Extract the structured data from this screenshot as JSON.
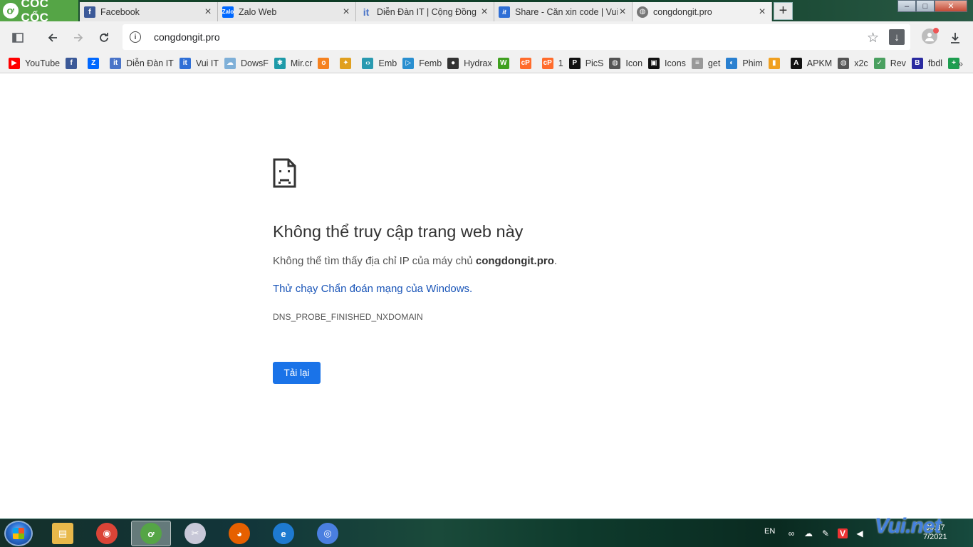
{
  "browser": {
    "brand_name": "CỐC CỐC",
    "tabs": [
      {
        "title": "Facebook",
        "icon": "facebook-icon",
        "color": "#3b5998",
        "glyph": "f"
      },
      {
        "title": "Zalo Web",
        "icon": "zalo-icon",
        "color": "#0068ff",
        "glyph": "Z"
      },
      {
        "title": "Diễn Đàn IT | Cộng Đồng IT",
        "icon": "it-icon",
        "color": "#4a74c8",
        "glyph": "it"
      },
      {
        "title": "Share - Căn xin code | Vui IT",
        "icon": "vuiit-icon",
        "color": "#2f6fd6",
        "glyph": "it"
      },
      {
        "title": "congdongit.pro",
        "icon": "globe-icon",
        "color": "#777777",
        "glyph": "◍"
      }
    ],
    "new_tab_label": "+",
    "window_buttons": {
      "minimize": "–",
      "maximize": "□",
      "close": "✕"
    }
  },
  "toolbar": {
    "url": "congdongit.pro",
    "info_glyph": "i"
  },
  "bookmarks": [
    {
      "label": "YouTube",
      "icon": "youtube-icon",
      "color": "#ff0000",
      "glyph": "▶"
    },
    {
      "label": "",
      "icon": "facebook-icon",
      "color": "#3b5998",
      "glyph": "f"
    },
    {
      "label": "",
      "icon": "zalo-icon",
      "color": "#0068ff",
      "glyph": "Z"
    },
    {
      "label": "Diễn Đàn IT",
      "icon": "it-icon",
      "color": "#4a74c8",
      "glyph": "it"
    },
    {
      "label": "Vui IT",
      "icon": "vuiit-icon",
      "color": "#2f6fd6",
      "glyph": "it"
    },
    {
      "label": "DowsF",
      "icon": "cloud-icon",
      "color": "#7fb0d8",
      "glyph": "☁"
    },
    {
      "label": "Mir.cr",
      "icon": "mirror-icon",
      "color": "#1e9aa8",
      "glyph": "✱"
    },
    {
      "label": "",
      "icon": "odnoklassniki-icon",
      "color": "#f58220",
      "glyph": "o"
    },
    {
      "label": "",
      "icon": "pinwheel-icon",
      "color": "#e0a020",
      "glyph": "✦"
    },
    {
      "label": "Emb",
      "icon": "code-icon",
      "color": "#2a9ab0",
      "glyph": "‹›"
    },
    {
      "label": "Femb",
      "icon": "play-icon",
      "color": "#2a8fd0",
      "glyph": "▷"
    },
    {
      "label": "Hydrax",
      "icon": "hydrax-icon",
      "color": "#333333",
      "glyph": "●"
    },
    {
      "label": "",
      "icon": "whatsapp-icon",
      "color": "#40a020",
      "glyph": "W"
    },
    {
      "label": "",
      "icon": "cpanel-icon",
      "color": "#ff6c2c",
      "glyph": "cP"
    },
    {
      "label": "1",
      "icon": "cpanel-icon",
      "color": "#ff6c2c",
      "glyph": "cP"
    },
    {
      "label": "PicS",
      "icon": "pics-icon",
      "color": "#111111",
      "glyph": "P"
    },
    {
      "label": "Icon",
      "icon": "globe-icon",
      "color": "#555555",
      "glyph": "◍"
    },
    {
      "label": "Icons",
      "icon": "icons-icon",
      "color": "#111111",
      "glyph": "▣"
    },
    {
      "label": "get",
      "icon": "document-icon",
      "color": "#999999",
      "glyph": "≡"
    },
    {
      "label": "Phim",
      "icon": "phim-icon",
      "color": "#2a80d0",
      "glyph": "◐"
    },
    {
      "label": "",
      "icon": "bar-chart-icon",
      "color": "#f0a020",
      "glyph": "▮"
    },
    {
      "label": "APKM",
      "icon": "apkm-icon",
      "color": "#111111",
      "glyph": "A"
    },
    {
      "label": "x2c",
      "icon": "globe-icon",
      "color": "#555555",
      "glyph": "◍"
    },
    {
      "label": "Rev",
      "icon": "checkmark-icon",
      "color": "#4aa060",
      "glyph": "✓"
    },
    {
      "label": "fbdl",
      "icon": "b-icon",
      "color": "#2a2aa0",
      "glyph": "B"
    },
    {
      "label": "",
      "icon": "sheets-icon",
      "color": "#1e9e50",
      "glyph": "+"
    }
  ],
  "bookmarks_more": "»",
  "error": {
    "heading": "Không thể truy cập trang web này",
    "desc_prefix": "Không thể tìm thấy địa chỉ IP của máy chủ ",
    "desc_host": "congdongit.pro",
    "desc_suffix": ".",
    "link": "Thử chạy Chẩn đoán mạng của Windows.",
    "code": "DNS_PROBE_FINISHED_NXDOMAIN",
    "reload_label": "Tải lại"
  },
  "taskbar": {
    "apps": [
      {
        "name": "explorer",
        "icon": "folder-icon",
        "color": "#e8b84a",
        "glyph": "▤"
      },
      {
        "name": "chrome",
        "icon": "chrome-icon",
        "color": "#db4437",
        "glyph": "◉"
      },
      {
        "name": "coccoc",
        "icon": "coccoc-icon",
        "color": "#55a546",
        "glyph": "ơ"
      },
      {
        "name": "paint",
        "icon": "paint-icon",
        "color": "#c8c8d8",
        "glyph": "✂"
      },
      {
        "name": "firefox",
        "icon": "firefox-icon",
        "color": "#e66000",
        "glyph": "◕"
      },
      {
        "name": "ie",
        "icon": "internet-explorer-icon",
        "color": "#1e7ad0",
        "glyph": "e"
      },
      {
        "name": "chromium",
        "icon": "chromium-icon",
        "color": "#4a7fe0",
        "glyph": "◎"
      }
    ],
    "lang": "EN",
    "clock_time": "09:37",
    "clock_date": "7/2021",
    "watermark": "Vui.net"
  }
}
